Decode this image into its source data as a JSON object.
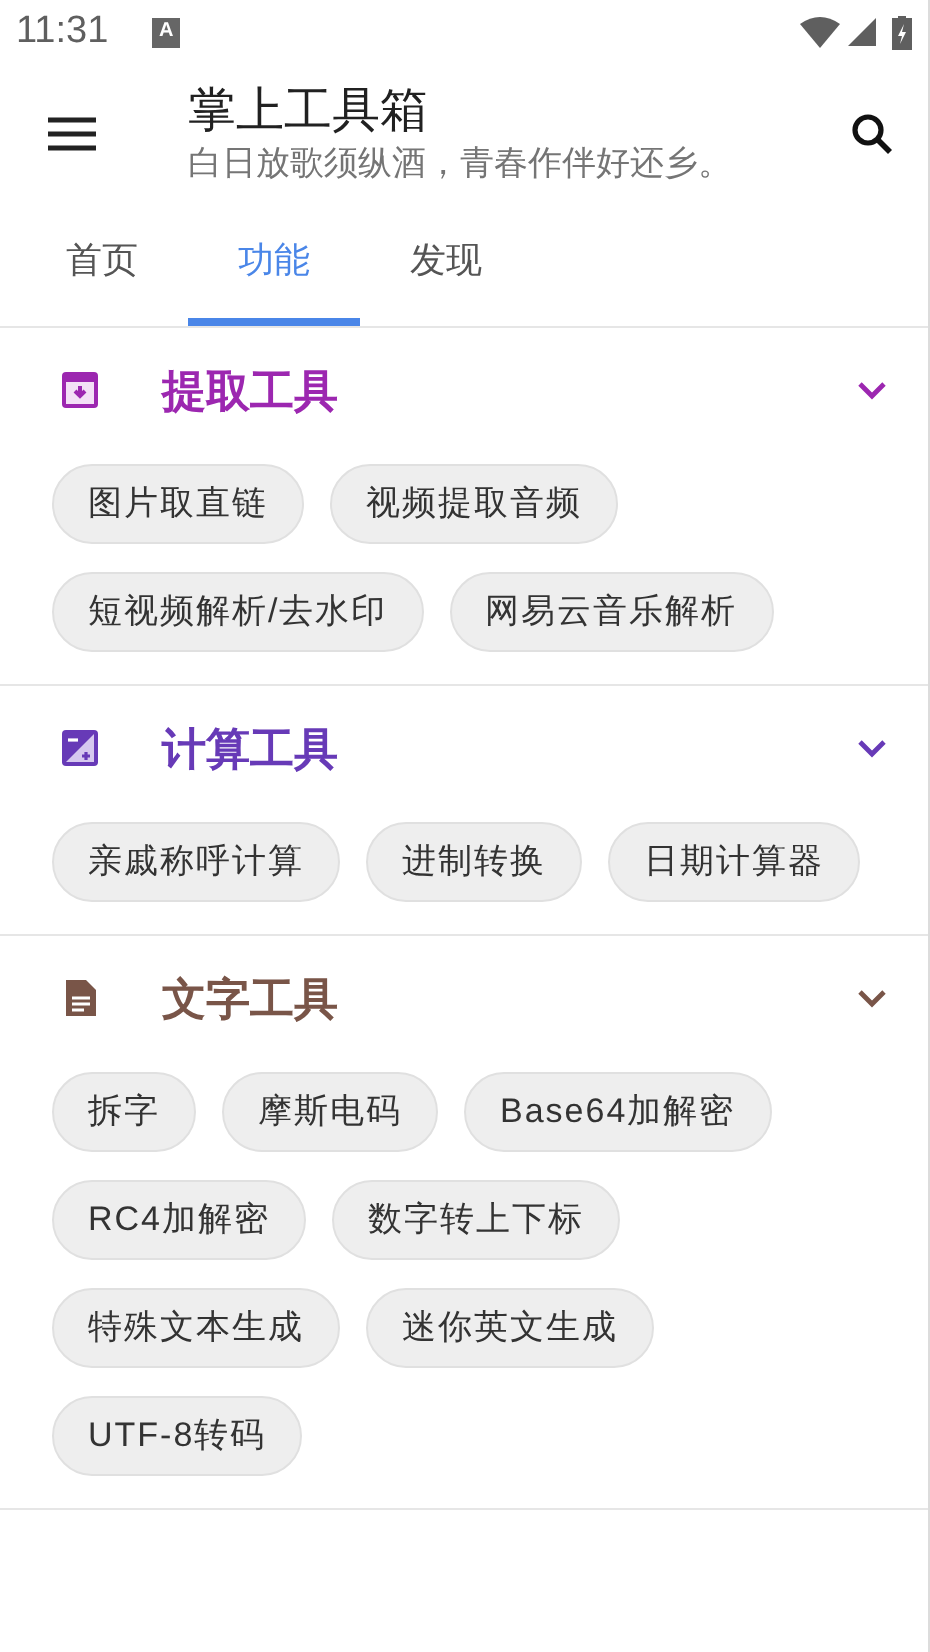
{
  "status_bar": {
    "time": "11:31",
    "notification": "A"
  },
  "app_bar": {
    "title": "掌上工具箱",
    "subtitle": "白日放歌须纵酒，青春作伴好还乡。"
  },
  "tabs": [
    {
      "label": "首页",
      "selected": false
    },
    {
      "label": "功能",
      "selected": true
    },
    {
      "label": "发现",
      "selected": false
    }
  ],
  "sections": [
    {
      "kind": "extract",
      "title": "提取工具",
      "color": "#9c27b0",
      "expanded": true,
      "tools": [
        "图片取直链",
        "视频提取音频",
        "短视频解析/去水印",
        "网易云音乐解析"
      ]
    },
    {
      "kind": "calc",
      "title": "计算工具",
      "color": "#673ab7",
      "expanded": true,
      "tools": [
        "亲戚称呼计算",
        "进制转换",
        "日期计算器"
      ]
    },
    {
      "kind": "text",
      "title": "文字工具",
      "color": "#795548",
      "expanded": true,
      "tools": [
        "拆字",
        "摩斯电码",
        "Base64加解密",
        "RC4加解密",
        "数字转上下标",
        "特殊文本生成",
        "迷你英文生成",
        "UTF-8转码"
      ]
    }
  ]
}
